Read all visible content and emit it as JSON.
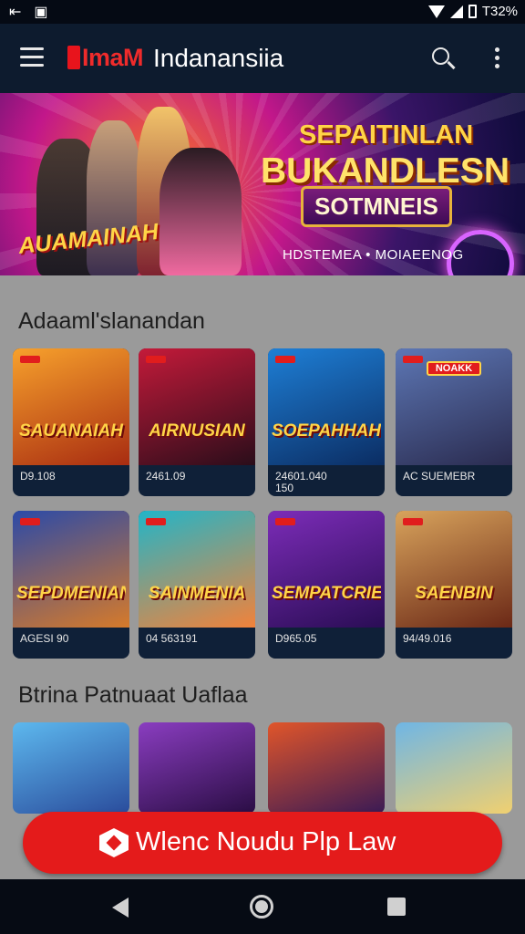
{
  "status_bar": {
    "time": "T32%",
    "left_icons": [
      "back-arrow-icon",
      "photo-icon"
    ]
  },
  "app_bar": {
    "brand": "ImaM",
    "title": "Indanansiia"
  },
  "hero": {
    "tag": "AUAMAINAH",
    "line1": "SEPAITINLAN",
    "line2": "BUKANDLESN",
    "line3": "SOTMNEIS",
    "footer": "HDSTEMEA • MOIAEENOG"
  },
  "section1": {
    "title": "Adaaml'slanandan",
    "cards": [
      {
        "title": "SAUANAIAH",
        "caption": "D9.108",
        "colors": [
          "#f7a12c",
          "#a82c11"
        ]
      },
      {
        "title": "AIRNUSIAN",
        "caption": "2461.09",
        "colors": [
          "#c41a3a",
          "#2a0d1a"
        ]
      },
      {
        "title": "SOEPAHHAH",
        "caption": "24601.040\n150",
        "colors": [
          "#1e7fd6",
          "#0b2d63"
        ]
      },
      {
        "title": "",
        "badge": "NOAKK",
        "caption": "AC SUEMEBR",
        "colors": [
          "#5d77b5",
          "#2a2b4f"
        ]
      },
      {
        "title": "SEPDMENIAN",
        "caption": "AGESI 90",
        "colors": [
          "#2b4aa8",
          "#d67a2a"
        ]
      },
      {
        "title": "SAINMENIA",
        "caption": "04 563191",
        "colors": [
          "#22b5c8",
          "#f2823a"
        ]
      },
      {
        "title": "SEMPATCRIE",
        "caption": "D965.05",
        "colors": [
          "#7c2cb8",
          "#2a0d55"
        ]
      },
      {
        "title": "SAENBIN",
        "caption": "94/49.016",
        "colors": [
          "#d8a35c",
          "#6b2816"
        ]
      }
    ]
  },
  "section2": {
    "title": "Btrina Patnuaat Uaflaa",
    "peeks": [
      {
        "colors": [
          "#5db8ee",
          "#2a4c9c"
        ]
      },
      {
        "colors": [
          "#8a3dc0",
          "#2a0d44"
        ]
      },
      {
        "colors": [
          "#e0552a",
          "#3a1a55"
        ]
      },
      {
        "colors": [
          "#6fb6e5",
          "#f0d070"
        ]
      }
    ]
  },
  "cta": {
    "label": "Wlenc Noudu Plp Law",
    "color": "#e41b1b"
  },
  "colors": {
    "app_bar": "#0d1b2e",
    "brand": "#ef2b2b",
    "background": "#9a9a9a"
  }
}
